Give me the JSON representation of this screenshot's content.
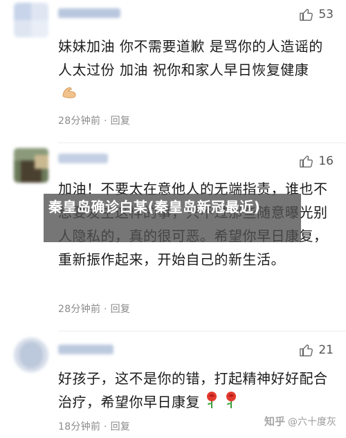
{
  "comments": [
    {
      "likes": "53",
      "text": "妹妹加油 你不需要道歉 是骂你的人造谣的人太过份 加油 祝你和家人早日恢复健康",
      "meta": "28分钟前 · 回复"
    },
    {
      "likes": "16",
      "text": "加油！不要太在意他人的无端指责，谁也不想要发生这样的事，只不过那些随意曝光别人隐私的，真的很可恶。希望你早日康复，重新振作起来，开始自己的新生活。",
      "meta": "28分钟前 · 回复"
    },
    {
      "likes": "21",
      "text": "好孩子，这不是你的错，打起精神好好配合治疗，希望你早日康复",
      "meta": "18分钟前 · 回复"
    }
  ],
  "overlay": {
    "title": "秦皇岛确诊白某(秦皇岛新冠最近)"
  },
  "watermark": {
    "brand": "知乎",
    "handle": "@六十度灰"
  },
  "icons": {
    "like": "thumbs-up-icon",
    "flex": "flexed-biceps-icon",
    "rose": "rose-icon"
  }
}
